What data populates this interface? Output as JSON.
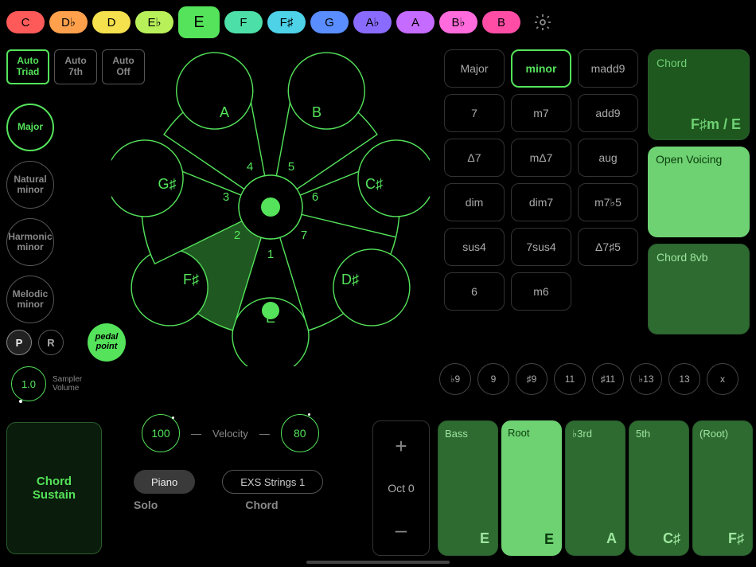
{
  "keys": [
    {
      "label": "C",
      "color": "#ff5a5a"
    },
    {
      "label": "D♭",
      "color": "#ffa04d"
    },
    {
      "label": "D",
      "color": "#f5e04d"
    },
    {
      "label": "E♭",
      "color": "#b8f05a"
    },
    {
      "label": "E",
      "color": "#54e35a",
      "active": true
    },
    {
      "label": "F",
      "color": "#4ddfa8"
    },
    {
      "label": "F♯",
      "color": "#4dd2e8"
    },
    {
      "label": "G",
      "color": "#5a8dff"
    },
    {
      "label": "A♭",
      "color": "#8a6bff"
    },
    {
      "label": "A",
      "color": "#c56bff"
    },
    {
      "label": "B♭",
      "color": "#ff6bdc"
    },
    {
      "label": "B",
      "color": "#ff4da6"
    }
  ],
  "auto": {
    "triad": "Auto\nTriad",
    "seventh": "Auto\n7th",
    "off": "Auto\nOff"
  },
  "scales": {
    "major": "Major",
    "natural": "Natural\nminor",
    "harmonic": "Harmonic\nminor",
    "melodic": "Melodic\nminor"
  },
  "pr": {
    "p": "P",
    "r": "R",
    "pedal": "pedal\npoint"
  },
  "sampler": {
    "value": "1.0",
    "label": "Sampler\nVolume"
  },
  "sustain": "Chord\nSustain",
  "wheel": {
    "degrees": [
      "1",
      "2",
      "3",
      "4",
      "5",
      "6",
      "7"
    ],
    "notes": {
      "n1": "E",
      "n2": "F♯",
      "n3": "G♯",
      "n4": "A",
      "n5": "B",
      "n6": "C♯",
      "n7": "D♯"
    }
  },
  "velocity": {
    "solo": "100",
    "label": "Velocity",
    "chord": "80"
  },
  "instruments": {
    "solo": "Piano",
    "chord": "EXS Strings 1",
    "soloLabel": "Solo",
    "chordLabel": "Chord"
  },
  "qualities": [
    "Major",
    "minor",
    "madd9",
    "7",
    "m7",
    "add9",
    "Δ7",
    "mΔ7",
    "aug",
    "dim",
    "dim7",
    "m7♭5",
    "sus4",
    "7sus4",
    "Δ7♯5",
    "6",
    "m6"
  ],
  "activeQuality": "minor",
  "rightPads": {
    "chord": {
      "label": "Chord",
      "value": "F♯m / E",
      "bg": "#1e581f",
      "text": "#6ed172"
    },
    "voicing": {
      "label": "Open Voicing",
      "bg": "#6ed172",
      "text": "#0a3d0c"
    },
    "eightvb": {
      "label": "Chord 8vb",
      "bg": "#2e6b31",
      "text": "#9ee69f"
    }
  },
  "tensions": [
    "♭9",
    "9",
    "♯9",
    "11",
    "♯11",
    "♭13",
    "13",
    "x"
  ],
  "octave": {
    "plus": "+",
    "label": "Oct 0",
    "minus": "–"
  },
  "notePads": [
    {
      "label": "Bass",
      "note": "E",
      "bg": "#2e6b31",
      "text": "#9ee69f"
    },
    {
      "label": "Root",
      "note": "E",
      "bg": "#6ed172",
      "text": "#0a3d0c"
    },
    {
      "label": "♭3rd",
      "note": "A",
      "bg": "#2e6b31",
      "text": "#9ee69f"
    },
    {
      "label": "5th",
      "note": "C♯",
      "bg": "#2e6b31",
      "text": "#9ee69f"
    },
    {
      "label": "(Root)",
      "note": "F♯",
      "bg": "#2e6b31",
      "text": "#9ee69f"
    }
  ]
}
